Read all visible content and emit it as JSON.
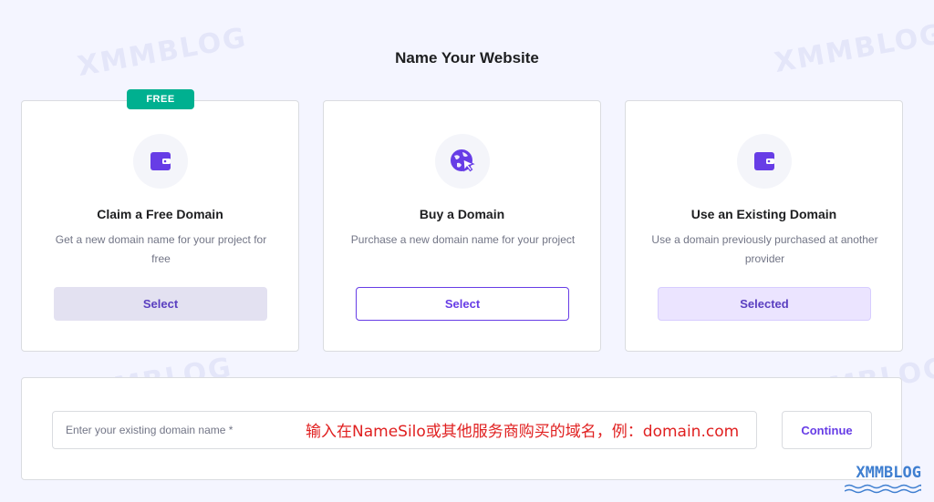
{
  "page": {
    "title": "Name Your Website"
  },
  "watermark": {
    "text": "XMMBLOG"
  },
  "cards": [
    {
      "badge": "FREE",
      "icon": "wallet-icon",
      "title": "Claim a Free Domain",
      "description": "Get a new domain name for your project for free",
      "button_label": "Select"
    },
    {
      "icon": "globe-cursor-icon",
      "title": "Buy a Domain",
      "description": "Purchase a new domain name for your project",
      "button_label": "Select"
    },
    {
      "icon": "wallet-icon",
      "title": "Use an Existing Domain",
      "description": "Use a domain previously purchased at another provider",
      "button_label": "Selected"
    }
  ],
  "domain_form": {
    "input_placeholder": "Enter your existing domain name *",
    "annotation": "输入在NameSilo或其他服务商购买的域名，例：domain.com",
    "continue_label": "Continue"
  },
  "colors": {
    "accent": "#673de6",
    "badge": "#00b090",
    "annotation": "#e02020",
    "background": "#f4f5ff"
  }
}
